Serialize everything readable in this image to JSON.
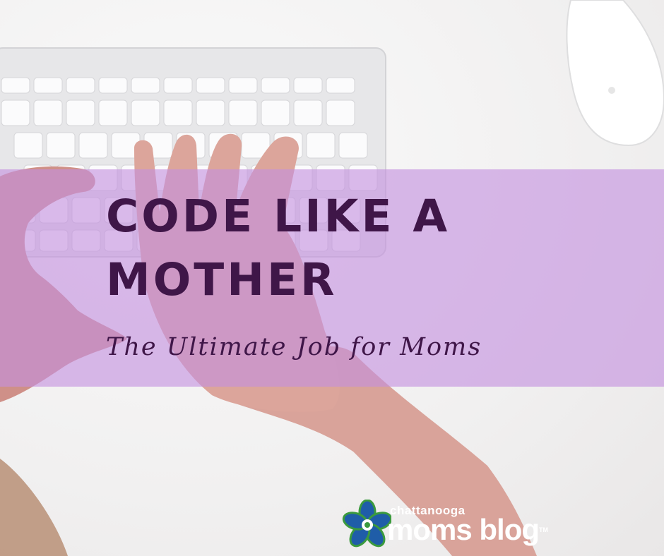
{
  "headline": "CODE LIKE A\nMOTHER",
  "subtitle": "The Ultimate Job for Moms",
  "logo": {
    "small_text": "chattanooga",
    "big_text": "moms blog",
    "trademark": "TM"
  },
  "colors": {
    "banner": "#c490de",
    "text": "#3f1648",
    "logo_text": "#ffffff",
    "logo_flower_blue": "#1f5da8",
    "logo_flower_green": "#3b9a3e"
  }
}
